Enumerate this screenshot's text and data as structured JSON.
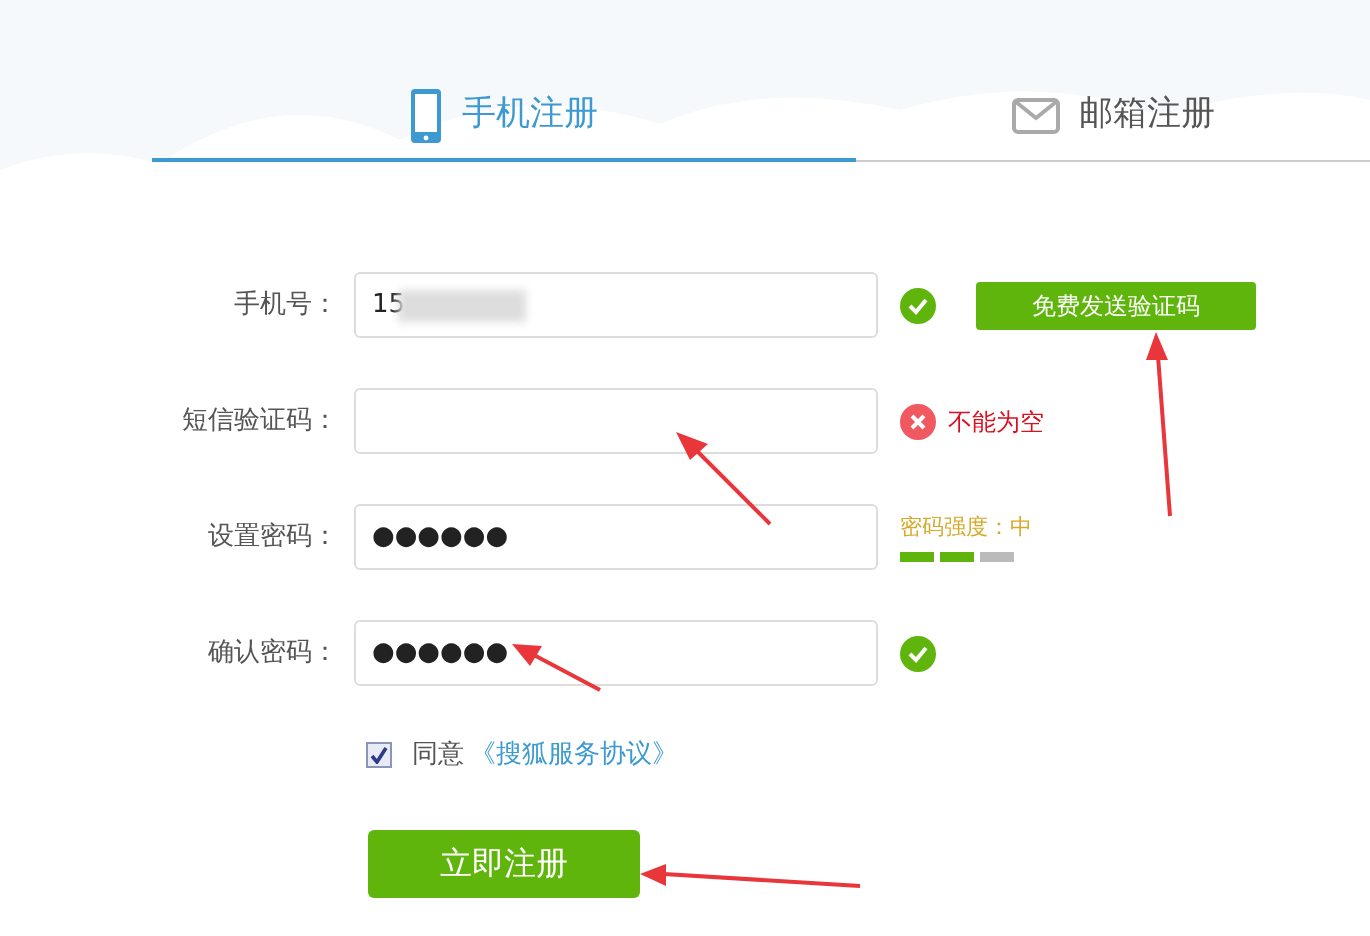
{
  "tabs": [
    {
      "label": "手机注册",
      "selected": true
    },
    {
      "label": "邮箱注册",
      "selected": false
    }
  ],
  "fields": [
    {
      "label": "手机号：",
      "value": "15",
      "masked": true,
      "kind": "ok",
      "action": "免费发送验证码"
    },
    {
      "label": "短信验证码：",
      "kind": "error",
      "message": "不能为空"
    },
    {
      "label": "设置密码：",
      "value": "●●●●●●",
      "kind": "strength",
      "strength_label": "密码强度：中",
      "level": 0.67
    },
    {
      "label": "确认密码：",
      "value": "●●●●●●",
      "kind": "ok"
    }
  ],
  "agreement": {
    "checked": true,
    "text": "同意",
    "link": "《搜狐服务协议》"
  },
  "submit": "立即注册"
}
